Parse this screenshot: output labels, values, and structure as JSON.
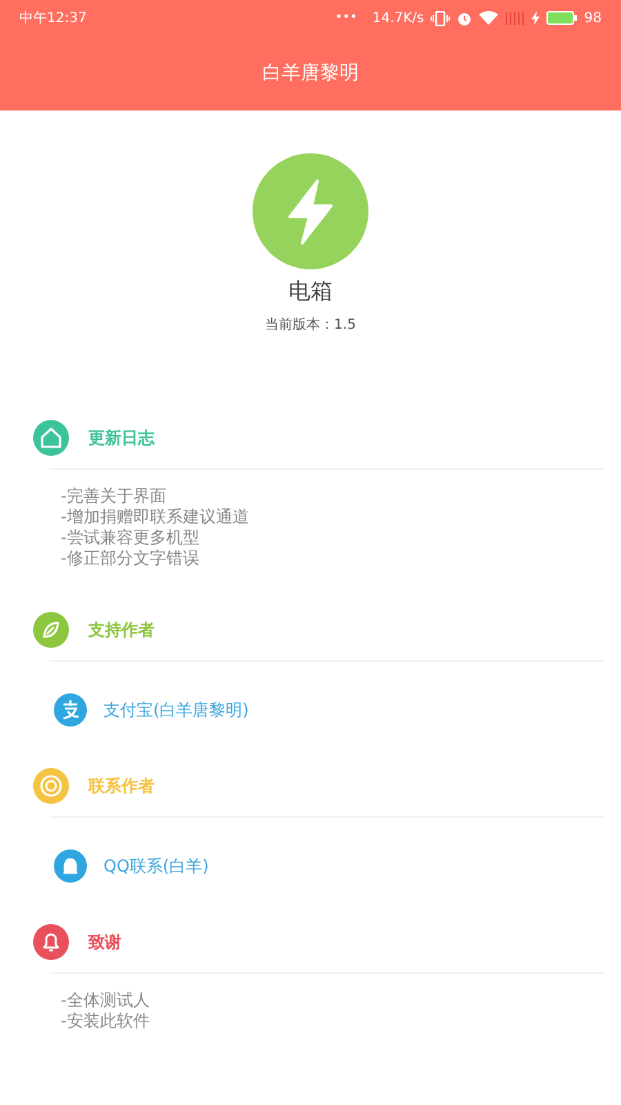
{
  "status_bar": {
    "time": "中午12:37",
    "dots": "•••",
    "speed": "14.7K/s",
    "battery": "98"
  },
  "title_bar": {
    "title": "白羊唐黎明"
  },
  "app": {
    "name": "电箱",
    "version": "当前版本：1.5"
  },
  "sections": [
    {
      "kind": "header",
      "title": "更新日志",
      "color": "#3cc39a"
    },
    {
      "kind": "notes",
      "lines": [
        "-完善关于界面",
        "-增加捐赠即联系建议通道",
        "-尝试兼容更多机型",
        "-修正部分文字错误"
      ]
    },
    {
      "kind": "header",
      "title": "支持作者",
      "color": "#8dc63f"
    },
    {
      "kind": "link",
      "text": "支付宝(白羊唐黎明)"
    },
    {
      "kind": "header",
      "title": "联系作者",
      "color": "#f5c342"
    },
    {
      "kind": "link",
      "text": "QQ联系(白羊)"
    },
    {
      "kind": "header",
      "title": "致谢",
      "color": "#e8505b"
    },
    {
      "kind": "notes",
      "lines": [
        "-全体测试人",
        "-安装此软件"
      ]
    }
  ]
}
